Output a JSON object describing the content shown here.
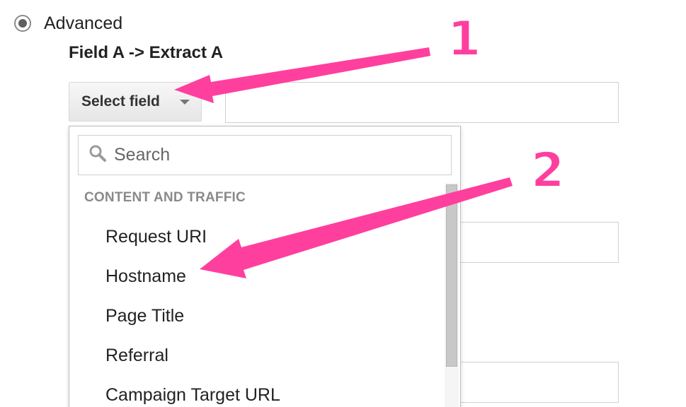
{
  "radio": {
    "label": "Advanced",
    "checked": true
  },
  "section": {
    "title": "Field A -> Extract A"
  },
  "select_field": {
    "label": "Select field",
    "icon": "chevron-down-icon"
  },
  "dropdown": {
    "search_placeholder": "Search",
    "search_icon": "search-icon",
    "group_header": "CONTENT AND TRAFFIC",
    "items": [
      {
        "label": "Request URI"
      },
      {
        "label": "Hostname"
      },
      {
        "label": "Page Title"
      },
      {
        "label": "Referral"
      },
      {
        "label": "Campaign Target URL"
      }
    ]
  },
  "annotations": {
    "step1": "1",
    "step2": "2",
    "arrow_color": "#ff3f9e"
  },
  "colors": {
    "annotation": "#ff3f9e",
    "scrollbar_thumb": "#c8c8c8",
    "group_header": "#8a8a8a"
  }
}
